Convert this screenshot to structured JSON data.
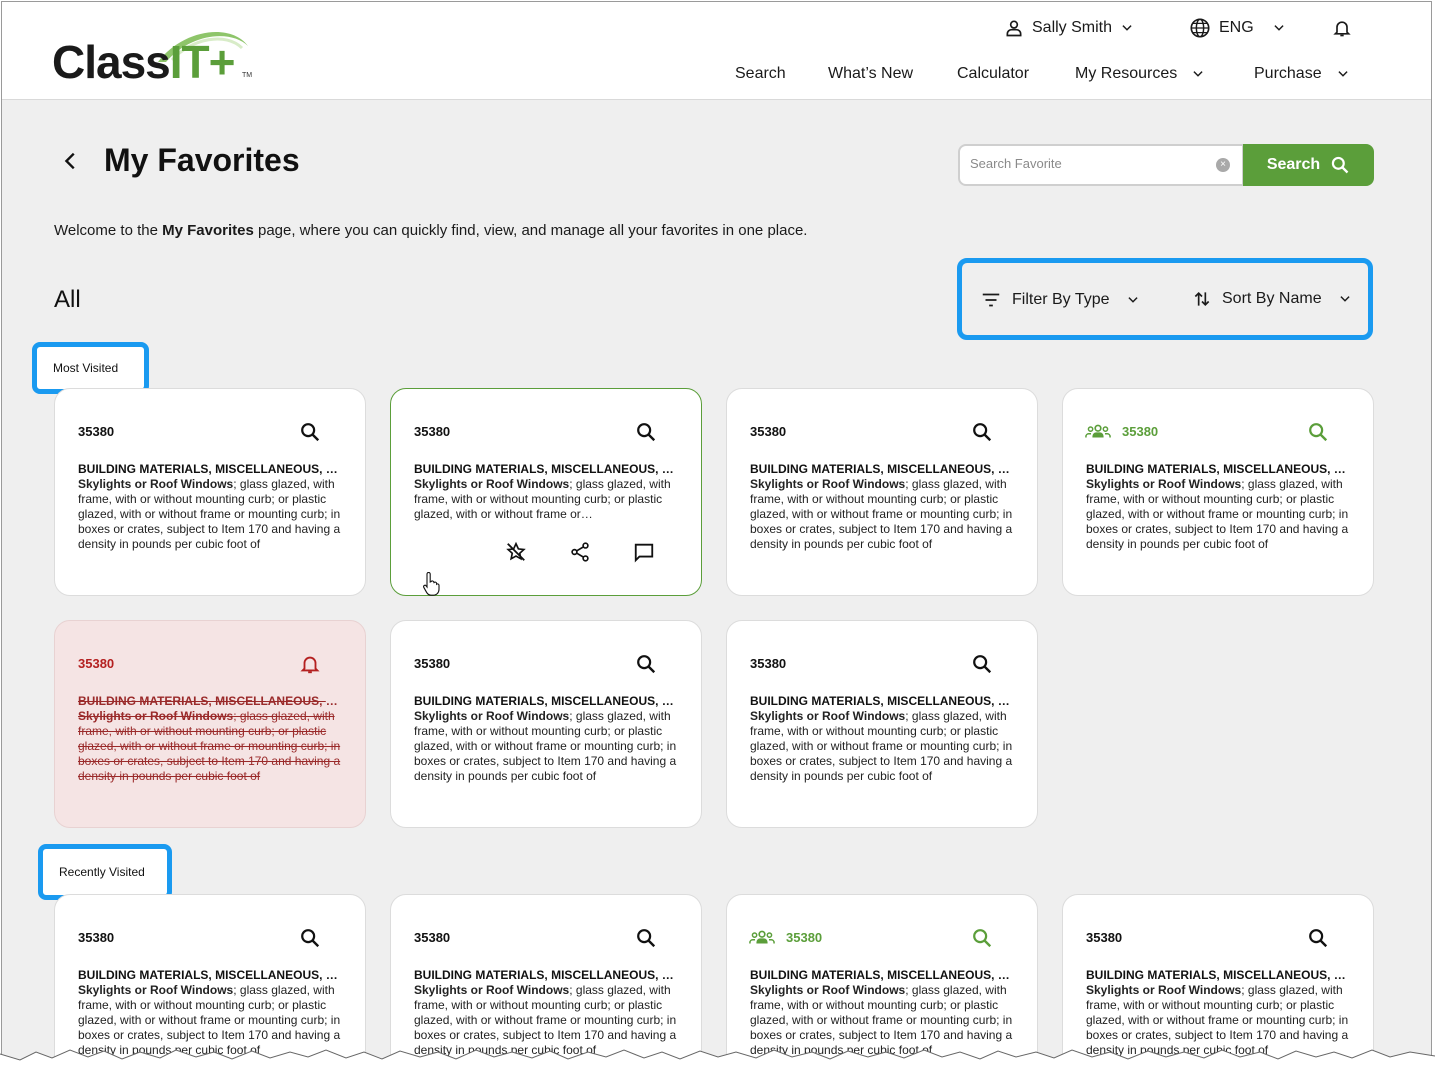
{
  "header": {
    "logo": {
      "text_dark": "Class",
      "text_green": "IT+",
      "tm": "TM"
    },
    "user": {
      "name": "Sally Smith"
    },
    "language": {
      "value": "ENG"
    },
    "nav": [
      {
        "label": "Search"
      },
      {
        "label": "What’s New"
      },
      {
        "label": "Calculator"
      },
      {
        "label": "My Resources"
      },
      {
        "label": "Purchase"
      }
    ]
  },
  "page": {
    "title": "My Favorites",
    "welcome_prefix": "Welcome to the ",
    "welcome_bold": "My Favorites",
    "welcome_suffix": " page, where you can quickly find, view, and manage all your favorites in one place.",
    "section_all": "All"
  },
  "search": {
    "placeholder": "Search Favorite",
    "button_label": "Search"
  },
  "filters": {
    "filter_label": "Filter By Type",
    "sort_label": "Sort By Name"
  },
  "sections": {
    "most_visited": "Most Visited",
    "recently_visited": "Recently Visited"
  },
  "card_template": {
    "code": "35380",
    "title": "BUILDING MATERIALS, MISCELLANEOUS, GROUP",
    "desc_bold": "Skylights or Roof Windows",
    "desc_rest": "; glass glazed, with frame, with or without mounting curb; or plastic glazed, with or without frame or mounting curb; in boxes or crates, subject to Item 170 and having a density in pounds per cubic foot of"
  },
  "cards": [
    {
      "code": "35380",
      "title": "BUILDING MATERIALS, MISCELLANEOUS, GROUP",
      "desc_bold": "Skylights or Roof Windows",
      "desc_rest": "; glass glazed, with frame, with or without mounting curb; or plastic glazed, with or without frame or mounting curb; in boxes or crates, subject to Item 170 and having a density in pounds per cubic foot of",
      "state": "normal"
    },
    {
      "code": "35380",
      "title": "BUILDING MATERIALS, MISCELLANEOUS, GROUP",
      "desc_bold": "Skylights or Roof Windows",
      "desc_rest": "; glass glazed, with frame, with or without mounting curb; or plastic glazed, with or without frame or…",
      "state": "hover"
    },
    {
      "code": "35380",
      "title": "BUILDING MATERIALS, MISCELLANEOUS, GROUP",
      "desc_bold": "Skylights or Roof Windows",
      "desc_rest": "; glass glazed, with frame, with or without mounting curb; or plastic glazed, with or without frame or mounting curb; in boxes or crates, subject to Item 170 and having a density in pounds per cubic foot of",
      "state": "normal"
    },
    {
      "code": "35380",
      "title": "BUILDING MATERIALS, MISCELLANEOUS, GROUP",
      "desc_bold": "Skylights or Roof Windows",
      "desc_rest": "; glass glazed, with frame, with or without mounting curb; or plastic glazed, with or without frame or mounting curb; in boxes or crates, subject to Item 170 and having a density in pounds per cubic foot of",
      "state": "shared"
    },
    {
      "code": "35380",
      "title": "BUILDING MATERIALS, MISCELLANEOUS, GROUP",
      "desc_bold": "Skylights or Roof Windows",
      "desc_rest": "; glass glazed, with frame, with or without mounting curb; or plastic glazed, with or without frame or mounting curb; in boxes or crates, subject to Item 170 and having a density in pounds per cubic foot of",
      "state": "removed"
    },
    {
      "code": "35380",
      "title": "BUILDING MATERIALS, MISCELLANEOUS, GROUP",
      "desc_bold": "Skylights or Roof Windows",
      "desc_rest": "; glass glazed, with frame, with or without mounting curb; or plastic glazed, with or without frame or mounting curb; in boxes or crates, subject to Item 170 and having a density in pounds per cubic foot of",
      "state": "normal"
    },
    {
      "code": "35380",
      "title": "BUILDING MATERIALS, MISCELLANEOUS, GROUP",
      "desc_bold": "Skylights or Roof Windows",
      "desc_rest": "; glass glazed, with frame, with or without mounting curb; or plastic glazed, with or without frame or mounting curb; in boxes or crates, subject to Item 170 and having a density in pounds per cubic foot of",
      "state": "normal"
    },
    {
      "code": "35380",
      "title": "BUILDING MATERIALS, MISCELLANEOUS, GROUP",
      "desc_bold": "Skylights or Roof Windows",
      "desc_rest": "; glass glazed, with frame, with or without mounting curb; or plastic glazed, with or without frame or mounting curb; in boxes or crates, subject to Item 170 and having a density in pounds per cubic foot of",
      "state": "normal"
    },
    {
      "code": "35380",
      "title": "BUILDING MATERIALS, MISCELLANEOUS, GROUP",
      "desc_bold": "Skylights or Roof Windows",
      "desc_rest": "; glass glazed, with frame, with or without mounting curb; or plastic glazed, with or without frame or mounting curb; in boxes or crates, subject to Item 170 and having a density in pounds per cubic foot of",
      "state": "normal"
    },
    {
      "code": "35380",
      "title": "BUILDING MATERIALS, MISCELLANEOUS, GROUP",
      "desc_bold": "Skylights or Roof Windows",
      "desc_rest": "; glass glazed, with frame, with or without mounting curb; or plastic glazed, with or without frame or mounting curb; in boxes or crates, subject to Item 170 and having a density in pounds per cubic foot of",
      "state": "shared"
    },
    {
      "code": "35380",
      "title": "BUILDING MATERIALS, MISCELLANEOUS, GROUP",
      "desc_bold": "Skylights or Roof Windows",
      "desc_rest": "; glass glazed, with frame, with or without mounting curb; or plastic glazed, with or without frame or mounting curb; in boxes or crates, subject to Item 170 and having a density in pounds per cubic foot of",
      "state": "normal"
    }
  ],
  "colors": {
    "accent_green": "#5b9e3a",
    "highlight_blue": "#1a9af0",
    "removed_red": "#b42020",
    "removed_bg": "#f5e4e4"
  },
  "icons": [
    "user-icon",
    "chevron-down-icon",
    "globe-icon",
    "bell-icon",
    "back-arrow-icon",
    "search-icon",
    "clear-icon",
    "filter-icon",
    "sort-icon",
    "group-icon",
    "unfavorite-star-icon",
    "share-icon",
    "comment-icon",
    "hand-cursor-icon"
  ]
}
